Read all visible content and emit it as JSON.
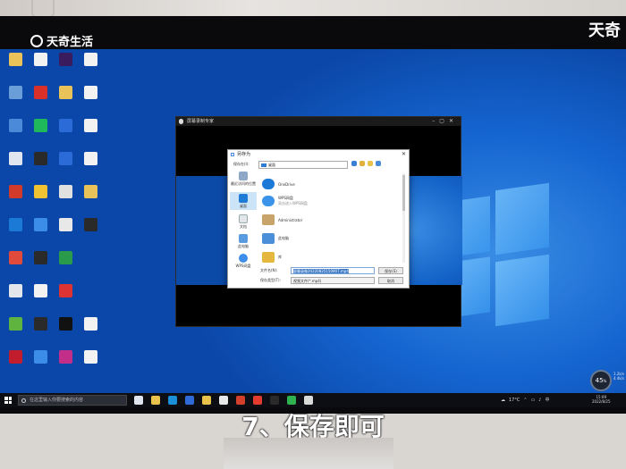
{
  "watermark": {
    "top_left": "天奇生活",
    "top_right": "天奇"
  },
  "app_window": {
    "title": "屏幕录制专家"
  },
  "dialog": {
    "title": "另存为",
    "save_in_label": "保存在(I):",
    "location": "桌面",
    "sidebar": [
      "最近访问的位置",
      "桌面",
      "文档",
      "此电脑",
      "WPS网盘"
    ],
    "items": [
      {
        "name": "OneDrive",
        "sub": ""
      },
      {
        "name": "WPS网盘",
        "sub": "双击进入WPS网盘"
      },
      {
        "name": "Administrator",
        "sub": ""
      },
      {
        "name": "此电脑",
        "sub": ""
      },
      {
        "name": "库",
        "sub": ""
      }
    ],
    "filename_label": "文件名(N):",
    "filename_value": "屏幕录像20220825150907.mp4",
    "filetype_label": "保存类型(T):",
    "filetype_value": "视频文件(*.mp4)",
    "save_button": "保存(S)",
    "cancel_button": "取消"
  },
  "taskbar": {
    "search_placeholder": "在这里输入你要搜索的内容",
    "temperature": "17°C",
    "ime": "中",
    "time": "15:09",
    "date": "2022/8/25"
  },
  "widget": {
    "percent": "45",
    "unit": "%",
    "up": "1.2k/s",
    "down": "4.4k/s"
  },
  "caption": "7、保存即可"
}
